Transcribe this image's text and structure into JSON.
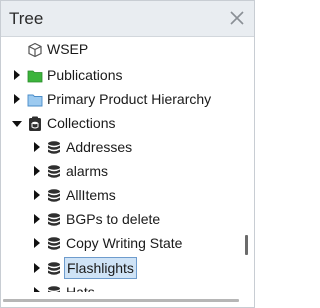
{
  "panel": {
    "title": "Tree"
  },
  "tree": {
    "items": [
      {
        "label": "WSEP",
        "icon": "cube-icon",
        "expand": "none"
      },
      {
        "label": "Publications",
        "icon": "folder-green-icon",
        "expand": "collapsed"
      },
      {
        "label": "Primary Product Hierarchy",
        "icon": "folder-blue-icon",
        "expand": "collapsed"
      },
      {
        "label": "Collections",
        "icon": "collection-icon",
        "expand": "expanded"
      },
      {
        "label": "Addresses",
        "icon": "database-icon",
        "expand": "collapsed"
      },
      {
        "label": "alarms",
        "icon": "database-icon",
        "expand": "collapsed"
      },
      {
        "label": "AllItems",
        "icon": "database-icon",
        "expand": "collapsed"
      },
      {
        "label": "BGPs to delete",
        "icon": "database-icon",
        "expand": "collapsed"
      },
      {
        "label": "Copy Writing State",
        "icon": "database-icon",
        "expand": "collapsed"
      },
      {
        "label": "Flashlights",
        "icon": "database-icon",
        "expand": "collapsed",
        "selected": true
      },
      {
        "label": "Hats",
        "icon": "database-icon",
        "expand": "collapsed"
      }
    ]
  },
  "colors": {
    "header_bg": "#e9edf1",
    "selection_bg": "#cfe3f6",
    "selection_border": "#6e9ccd",
    "folder_green": "#3cb43c",
    "folder_blue": "#78b4e6"
  }
}
